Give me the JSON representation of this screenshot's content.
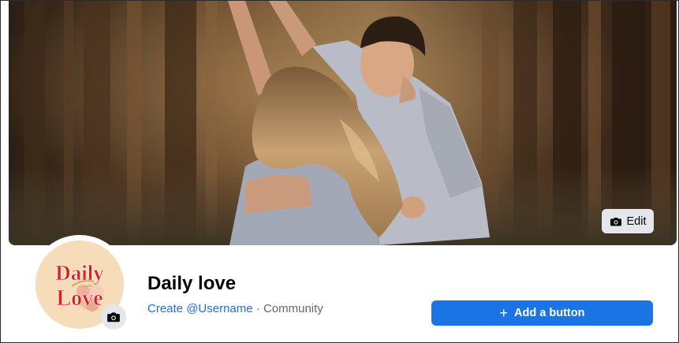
{
  "cover": {
    "edit_label": "Edit",
    "edit_icon": "camera-icon"
  },
  "profile": {
    "avatar_text_line1": "Daily",
    "avatar_text_line2": "Love",
    "avatar_camera_icon": "camera-icon",
    "name": "Daily love",
    "username_link": "Create @Username",
    "separator": " · ",
    "category": "Community"
  },
  "actions": {
    "add_button_label": "Add a button",
    "add_button_icon": "plus-icon"
  },
  "colors": {
    "primary_button": "#1b74e4",
    "link": "#216fdb",
    "secondary_text": "#65676b",
    "avatar_text": "#d9201f"
  }
}
